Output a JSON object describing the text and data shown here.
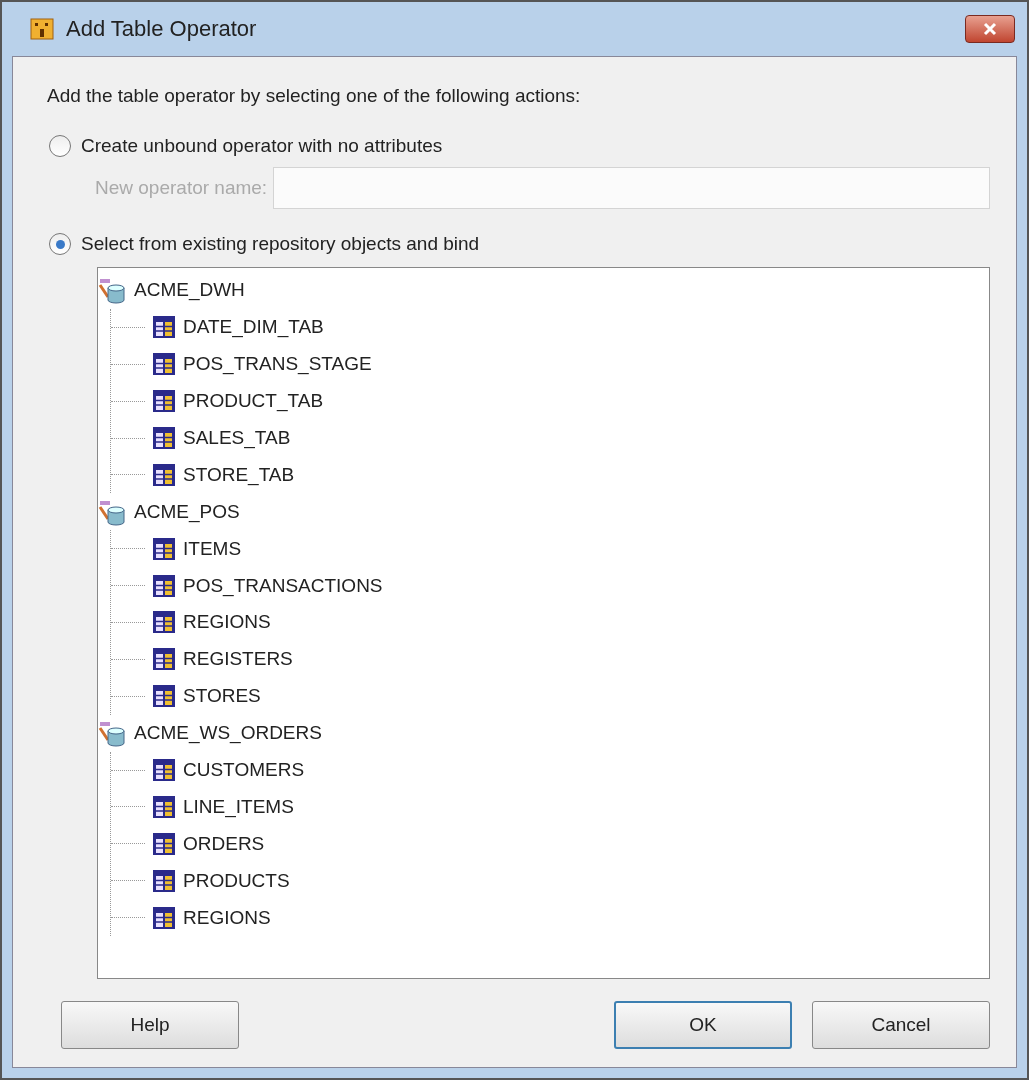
{
  "window": {
    "title": "Add Table Operator"
  },
  "instruction": "Add the table operator by selecting one of the following actions:",
  "options": [
    {
      "label": "Create unbound operator with no attributes",
      "selected": false
    },
    {
      "label": "Select from existing repository objects and bind",
      "selected": true
    }
  ],
  "name_field": {
    "label": "New operator name:",
    "disabled": true
  },
  "tree": [
    {
      "label": "ACME_DWH",
      "children": [
        {
          "label": "DATE_DIM_TAB"
        },
        {
          "label": "POS_TRANS_STAGE"
        },
        {
          "label": "PRODUCT_TAB"
        },
        {
          "label": "SALES_TAB"
        },
        {
          "label": "STORE_TAB"
        }
      ]
    },
    {
      "label": "ACME_POS",
      "children": [
        {
          "label": "ITEMS"
        },
        {
          "label": "POS_TRANSACTIONS"
        },
        {
          "label": "REGIONS"
        },
        {
          "label": "REGISTERS"
        },
        {
          "label": "STORES"
        }
      ]
    },
    {
      "label": "ACME_WS_ORDERS",
      "children": [
        {
          "label": "CUSTOMERS"
        },
        {
          "label": "LINE_ITEMS"
        },
        {
          "label": "ORDERS"
        },
        {
          "label": "PRODUCTS"
        },
        {
          "label": "REGIONS"
        }
      ]
    }
  ],
  "buttons": [
    {
      "label": "Help",
      "kind": "secondary"
    },
    {
      "label": "OK",
      "kind": "default"
    },
    {
      "label": "Cancel",
      "kind": "normal"
    }
  ]
}
